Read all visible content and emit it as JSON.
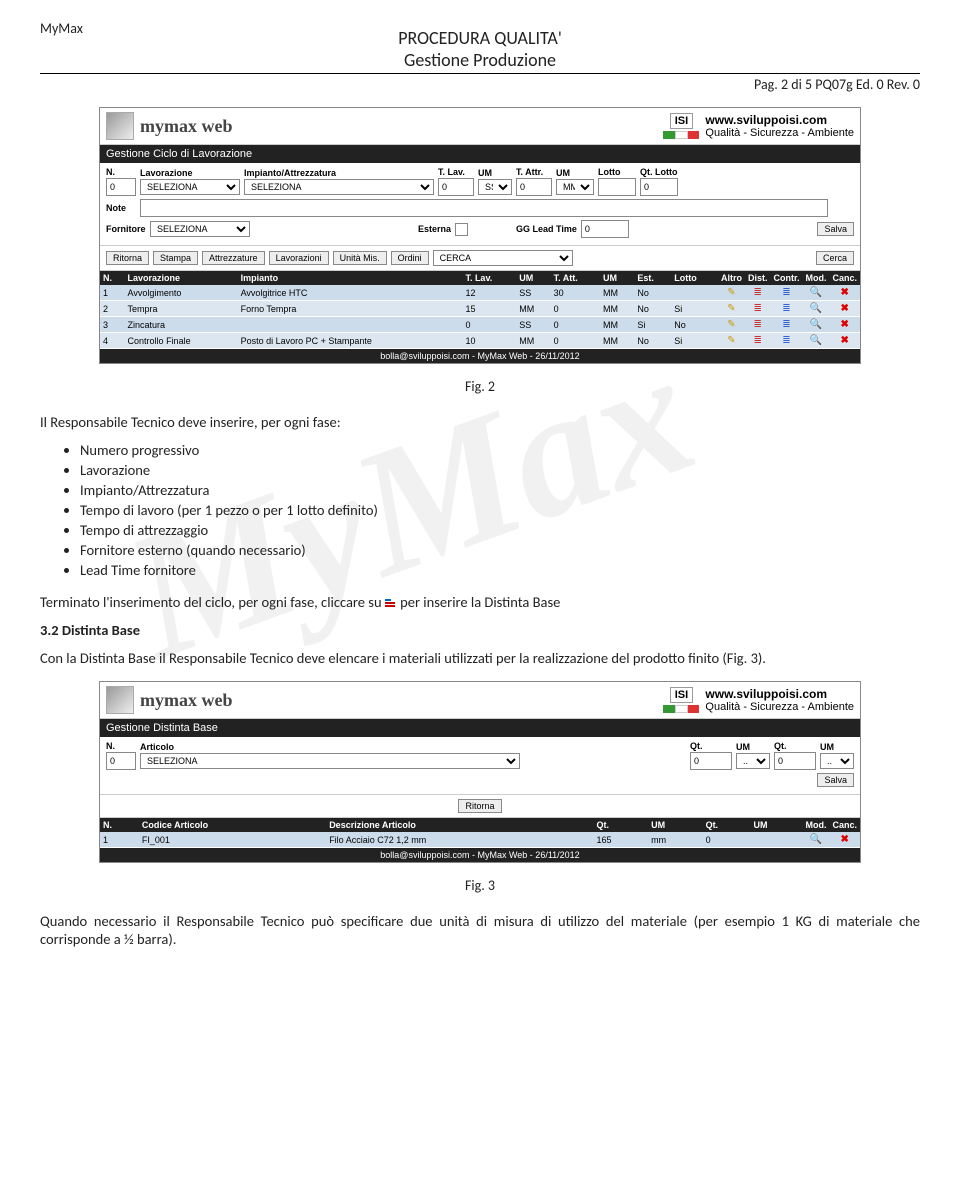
{
  "doc": {
    "top_left": "MyMax",
    "title_line1": "PROCEDURA QUALITA'",
    "title_line2": "Gestione Produzione",
    "pag_line": "Pag. 2 di 5 PQ07g Ed. 0 Rev. 0"
  },
  "watermark": "MyMax",
  "screenshot1": {
    "app_title": "mymax web",
    "isi_label": "ISI",
    "url": "www.sviluppoisi.com",
    "tagline": "Qualità - Sicurezza - Ambiente",
    "section_title": "Gestione Ciclo di Lavorazione",
    "form": {
      "labels": {
        "n": "N.",
        "lavorazione": "Lavorazione",
        "impianto": "Impianto/Attrezzatura",
        "tlav": "T. Lav.",
        "um1": "UM",
        "tattr": "T. Attr.",
        "um2": "UM",
        "lotto": "Lotto",
        "qtlotto": "Qt. Lotto",
        "note": "Note",
        "fornitore": "Fornitore",
        "esterna": "Esterna",
        "ggleadtime": "GG Lead Time"
      },
      "values": {
        "n": "0",
        "lavorazione_opt": "SELEZIONA",
        "impianto_opt": "SELEZIONA",
        "tlav": "0",
        "um1_opt": "SS",
        "tattr": "0",
        "um2_opt": "MM",
        "lotto": "",
        "qtlotto": "0",
        "note": "",
        "fornitore_opt": "SELEZIONA",
        "ggleadtime": "0"
      },
      "salva_btn": "Salva"
    },
    "btnrow": {
      "ritorna": "Ritorna",
      "stampa": "Stampa",
      "attrezzature": "Attrezzature",
      "lavorazioni": "Lavorazioni",
      "unita": "Unità Mis.",
      "ordini": "Ordini",
      "cerca_input": "CERCA",
      "cerca_btn": "Cerca"
    },
    "table": {
      "headers": [
        "N.",
        "Lavorazione",
        "Impianto",
        "T. Lav.",
        "UM",
        "T. Att.",
        "UM",
        "Est.",
        "Lotto",
        "Altro",
        "Dist.",
        "Contr.",
        "Mod.",
        "Canc."
      ],
      "rows": [
        {
          "n": "1",
          "lav": "Avvolgimento",
          "imp": "Avvolgitrice HTC",
          "tlav": "12",
          "um1": "SS",
          "tatt": "30",
          "um2": "MM",
          "est": "No",
          "lotto": "",
          "altro": ""
        },
        {
          "n": "2",
          "lav": "Tempra",
          "imp": "Forno Tempra",
          "tlav": "15",
          "um1": "MM",
          "tatt": "0",
          "um2": "MM",
          "est": "No",
          "lotto": "Si",
          "altro": ""
        },
        {
          "n": "3",
          "lav": "Zincatura",
          "imp": "",
          "tlav": "0",
          "um1": "SS",
          "tatt": "0",
          "um2": "MM",
          "est": "Si",
          "lotto": "No",
          "altro": ""
        },
        {
          "n": "4",
          "lav": "Controllo Finale",
          "imp": "Posto di Lavoro PC + Stampante",
          "tlav": "10",
          "um1": "MM",
          "tatt": "0",
          "um2": "MM",
          "est": "No",
          "lotto": "Si",
          "altro": ""
        }
      ]
    },
    "footer": "bolla@sviluppoisi.com - MyMax Web - 26/11/2012"
  },
  "fig2_label": "Fig. 2",
  "para1": "Il Responsabile Tecnico deve inserire, per ogni fase:",
  "bullets": [
    "Numero progressivo",
    "Lavorazione",
    "Impianto/Attrezzatura",
    "Tempo di lavoro (per 1 pezzo o per 1 lotto definito)",
    "Tempo di attrezzaggio",
    "Fornitore esterno (quando necessario)",
    "Lead Time fornitore"
  ],
  "para2_pre": "Terminato l'inserimento del ciclo, per ogni fase, cliccare su ",
  "para2_post": " per inserire la Distinta Base",
  "section32_title": "3.2 Distinta Base",
  "section32_body": "Con la Distinta Base il Responsabile Tecnico deve elencare i materiali utilizzati per la realizzazione del prodotto finito (Fig. 3).",
  "screenshot2": {
    "app_title": "mymax web",
    "isi_label": "ISI",
    "url": "www.sviluppoisi.com",
    "tagline": "Qualità - Sicurezza - Ambiente",
    "section_title": "Gestione Distinta Base",
    "form": {
      "labels": {
        "n": "N.",
        "articolo": "Articolo",
        "qt1": "Qt.",
        "um1": "UM",
        "qt2": "Qt.",
        "um2": "UM"
      },
      "values": {
        "n": "0",
        "articolo_opt": "SELEZIONA",
        "qt1": "0",
        "um1_opt": "..",
        "qt2": "0",
        "um2_opt": ".."
      },
      "salva_btn": "Salva"
    },
    "ritorna_btn": "Ritorna",
    "table": {
      "headers": [
        "N.",
        "Codice Articolo",
        "Descrizione Articolo",
        "Qt.",
        "UM",
        "Qt.",
        "UM",
        "Mod.",
        "Canc."
      ],
      "rows": [
        {
          "n": "1",
          "cod": "FI_001",
          "desc": "Filo Acciaio C72 1,2 mm",
          "qt1": "165",
          "um1": "mm",
          "qt2": "0",
          "um2": ""
        }
      ]
    },
    "footer": "bolla@sviluppoisi.com - MyMax Web - 26/11/2012"
  },
  "fig3_label": "Fig. 3",
  "para3": "Quando necessario il Responsabile Tecnico può specificare due unità di misura di utilizzo del materiale (per esempio 1 KG di materiale che corrisponde a ½ barra)."
}
